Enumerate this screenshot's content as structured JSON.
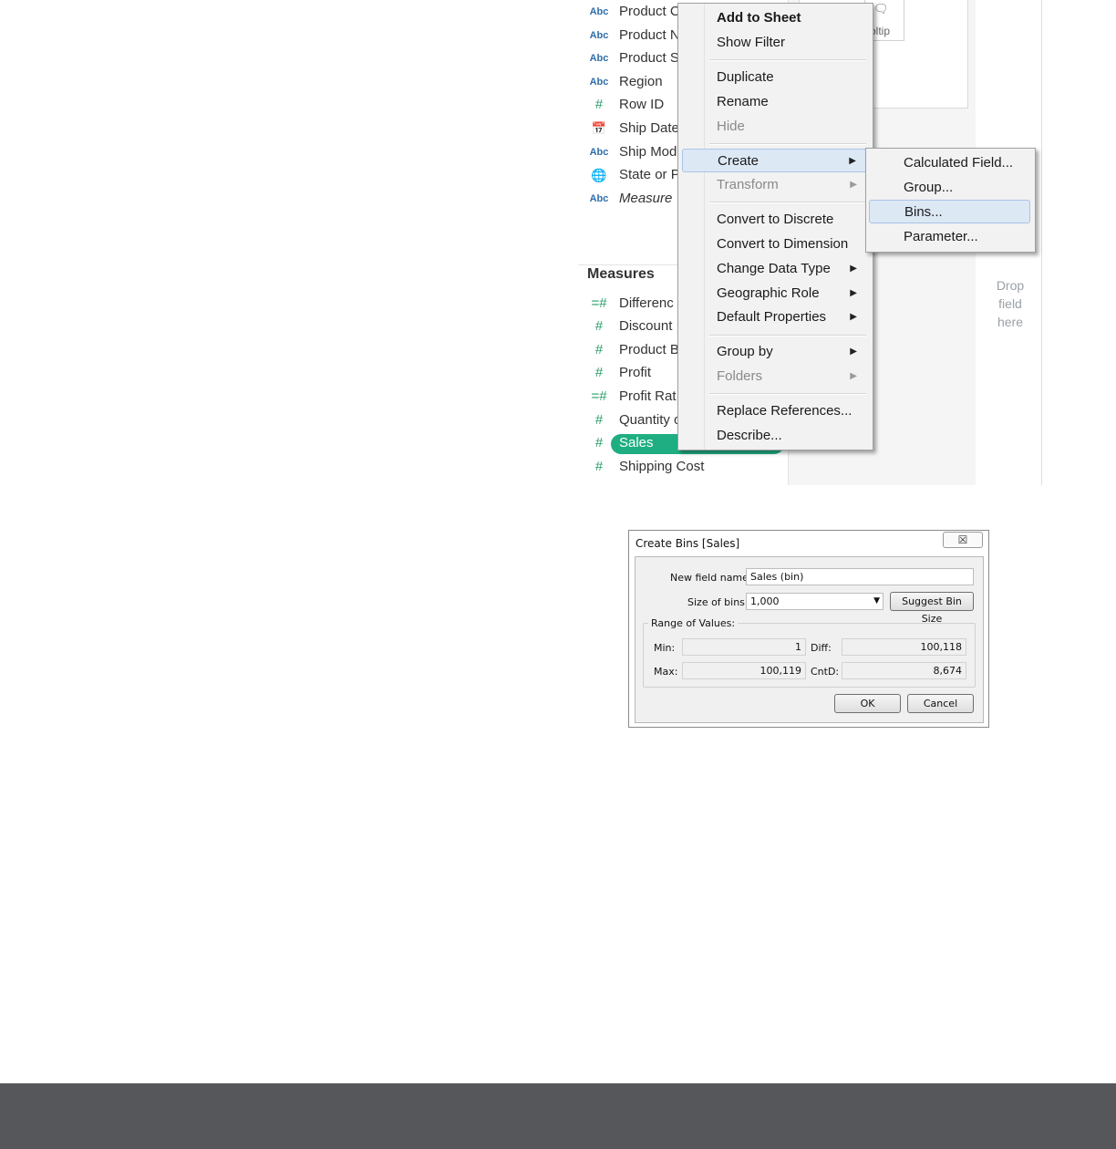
{
  "fields_pane": {
    "dimensions": [
      {
        "icon": "Abc",
        "label": "Product C"
      },
      {
        "icon": "Abc",
        "label": "Product N"
      },
      {
        "icon": "Abc",
        "label": "Product S"
      },
      {
        "icon": "Abc",
        "label": "Region"
      },
      {
        "icon": "#",
        "label": "Row ID"
      },
      {
        "icon": "calendar",
        "label": "Ship Date"
      },
      {
        "icon": "Abc",
        "label": "Ship Mod"
      },
      {
        "icon": "globe",
        "label": "State or P"
      },
      {
        "icon": "Abc",
        "label": "Measure"
      }
    ],
    "measures_header": "Measures",
    "measures": [
      {
        "icon": "=#",
        "label": "Differenc"
      },
      {
        "icon": "#",
        "label": "Discount"
      },
      {
        "icon": "#",
        "label": "Product B"
      },
      {
        "icon": "#",
        "label": "Profit"
      },
      {
        "icon": "=#",
        "label": "Profit Rat"
      },
      {
        "icon": "#",
        "label": "Quantity o"
      },
      {
        "icon": "#",
        "label": "Sales"
      },
      {
        "icon": "#",
        "label": "Shipping Cost"
      }
    ],
    "tooltip_label": "oltip",
    "drop_text": [
      "Drop",
      "field",
      "here"
    ]
  },
  "context_menu": {
    "items": [
      {
        "label": "Add to Sheet"
      },
      {
        "label": "Show Filter"
      },
      {
        "label": "Duplicate"
      },
      {
        "label": "Rename"
      },
      {
        "label": "Hide"
      },
      {
        "label": "Create"
      },
      {
        "label": "Transform"
      },
      {
        "label": "Convert to Discrete"
      },
      {
        "label": "Convert to Dimension"
      },
      {
        "label": "Change Data Type"
      },
      {
        "label": "Geographic Role"
      },
      {
        "label": "Default Properties"
      },
      {
        "label": "Group by"
      },
      {
        "label": "Folders"
      },
      {
        "label": "Replace References..."
      },
      {
        "label": "Describe..."
      }
    ]
  },
  "create_submenu": {
    "items": [
      {
        "label": "Calculated Field..."
      },
      {
        "label": "Group..."
      },
      {
        "label": "Bins..."
      },
      {
        "label": "Parameter..."
      }
    ]
  },
  "dialog": {
    "title": "Create Bins [Sales]",
    "new_field_label": "New field name:",
    "new_field_value": "Sales (bin)",
    "size_label": "Size of bins:",
    "size_value": "1,000",
    "suggest_button": "Suggest Bin Size",
    "range_legend": "Range of Values:",
    "min_label": "Min:",
    "min_value": "1",
    "diff_label": "Diff:",
    "diff_value": "100,118",
    "max_label": "Max:",
    "max_value": "100,119",
    "cntd_label": "CntD:",
    "cntd_value": "8,674",
    "ok_button": "OK",
    "cancel_button": "Cancel",
    "close_glyph": "☒"
  },
  "colors": {
    "accent_green": "#1fae82",
    "menu_highlight": "#dde8f5",
    "footer_bar": "#55575b"
  }
}
